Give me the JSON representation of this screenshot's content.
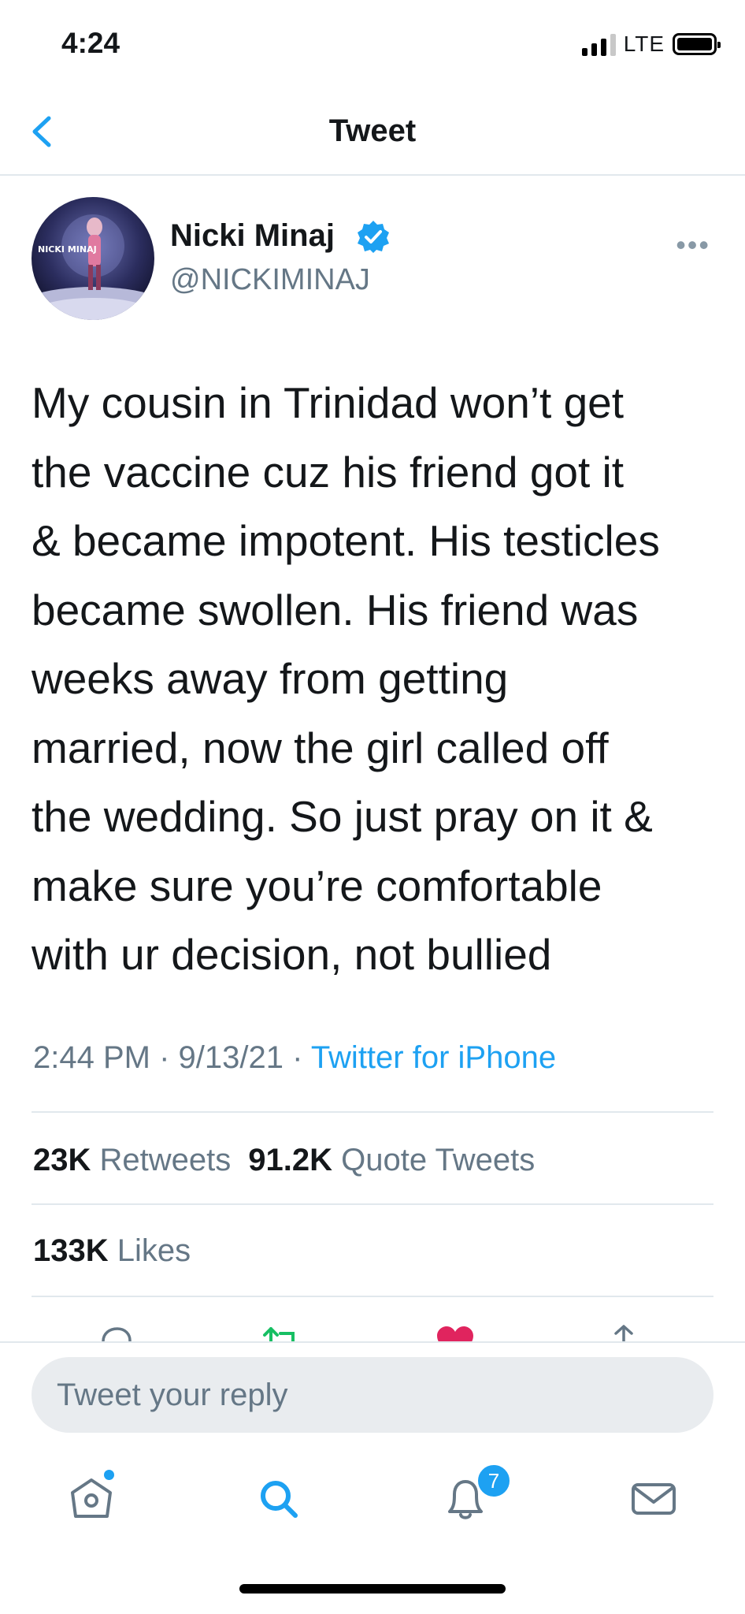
{
  "status_bar": {
    "time": "4:24",
    "network": "LTE"
  },
  "nav": {
    "title": "Tweet"
  },
  "tweet": {
    "author_name": "Nicki Minaj",
    "handle": "@NICKIMINAJ",
    "avatar_text": "NICKI MINAJ",
    "text_lines": [
      "My cousin in Trinidad won’t get",
      "the vaccine cuz his friend got it",
      "& became impotent. His testicles",
      "became swollen. His friend was",
      "weeks away from getting",
      "married, now the girl called off",
      "the wedding. So just pray on it &",
      "make sure you’re comfortable",
      "with ur decision, not bullied"
    ],
    "time": "2:44 PM",
    "date": "9/13/21",
    "separator": " · ",
    "source": "Twitter for iPhone",
    "retweets_count": "23K",
    "retweets_label": "Retweets",
    "quotes_count": "91.2K",
    "quotes_label": "Quote Tweets",
    "likes_count": "133K",
    "likes_label": "Likes"
  },
  "reply": {
    "placeholder": "Tweet your reply"
  },
  "tabbar": {
    "notifications_badge": "7"
  },
  "colors": {
    "accent": "#1da1f2",
    "secondary_text": "#657786",
    "retweet": "#17bf63",
    "like": "#e0245e"
  },
  "icons": [
    "back-chevron-icon",
    "verified-icon",
    "more-icon",
    "reply-icon",
    "retweet-icon",
    "like-icon",
    "share-icon",
    "home-icon",
    "search-icon",
    "notifications-icon",
    "messages-icon"
  ]
}
